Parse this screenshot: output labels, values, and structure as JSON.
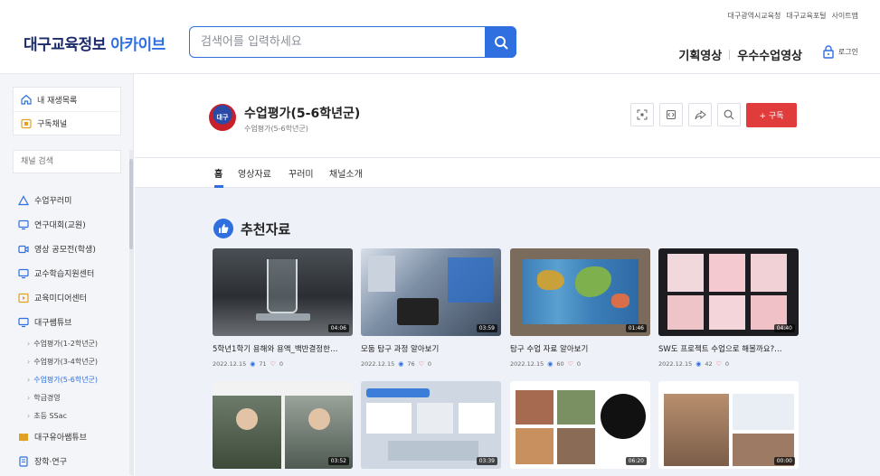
{
  "header": {
    "logo_main": "대구교육정보",
    "logo_accent": "아카이브",
    "search_placeholder": "검색어를 입력하세요",
    "util_links": [
      "대구광역시교육청",
      "대구교육포털",
      "사이트맵"
    ],
    "gnb": [
      "기획영상",
      "우수수업영상"
    ],
    "login_label": "로그인",
    "accent_color": "#2f6fe0"
  },
  "sidebar": {
    "top_items": [
      {
        "label": "내 재생목록",
        "icon": "home-icon"
      },
      {
        "label": "구독채널",
        "icon": "subscribe-icon"
      }
    ],
    "search_placeholder": "채널 검색",
    "menu": [
      {
        "label": "수업꾸러미",
        "icon": "triangle-icon"
      },
      {
        "label": "연구대회(교원)",
        "icon": "monitor-icon"
      },
      {
        "label": "영상 공모전(학생)",
        "icon": "video-icon"
      },
      {
        "label": "교수학습지원센터",
        "icon": "monitor-icon"
      },
      {
        "label": "교육미디어센터",
        "icon": "media-icon"
      },
      {
        "label": "대구쌤튜브",
        "icon": "monitor-icon"
      }
    ],
    "submenu": [
      "수업평가(1-2학년군)",
      "수업평가(3-4학년군)",
      "수업평가(5-6학년군)",
      "학급경영",
      "초등 SSac"
    ],
    "active_sub": "수업평가(5-6학년군)",
    "bottom_menu": [
      {
        "label": "대구유아쌤튜브",
        "icon": "book-icon"
      },
      {
        "label": "장학·연구",
        "icon": "doc-icon"
      }
    ]
  },
  "channel": {
    "avatar_text": "대구",
    "title": "수업평가(5-6학년군)",
    "subtitle": "수업평가(5-6학년군)",
    "subscribe_label": "+ 구독",
    "subscribe_color": "#e03c3c",
    "tabs": [
      "홈",
      "영상자료",
      "꾸러미",
      "채널소개"
    ],
    "active_tab": "홈"
  },
  "feed": {
    "section_title": "추천자료",
    "cards": [
      {
        "title": "5학년1학기 용해와 용액_백반결정한…",
        "date": "2022.12.15",
        "views": "71",
        "likes": "0",
        "duration": "04:06"
      },
      {
        "title": "모둠 탐구 과정 알아보기",
        "date": "2022.12.15",
        "views": "76",
        "likes": "0",
        "duration": "03:59"
      },
      {
        "title": "탐구 수업 자료 알아보기",
        "date": "2022.12.15",
        "views": "60",
        "likes": "0",
        "duration": "01:46"
      },
      {
        "title": "SW도 프로젝트 수업으로 해볼까요?…",
        "date": "2022.12.15",
        "views": "42",
        "likes": "0",
        "duration": "04:40"
      },
      {
        "title": "",
        "date": "",
        "views": "",
        "likes": "",
        "duration": "03:52"
      },
      {
        "title": "",
        "date": "",
        "views": "",
        "likes": "",
        "duration": "03:39"
      },
      {
        "title": "",
        "date": "",
        "views": "",
        "likes": "",
        "duration": "06:20"
      },
      {
        "title": "",
        "date": "",
        "views": "",
        "likes": "",
        "duration": "00:00"
      }
    ]
  }
}
